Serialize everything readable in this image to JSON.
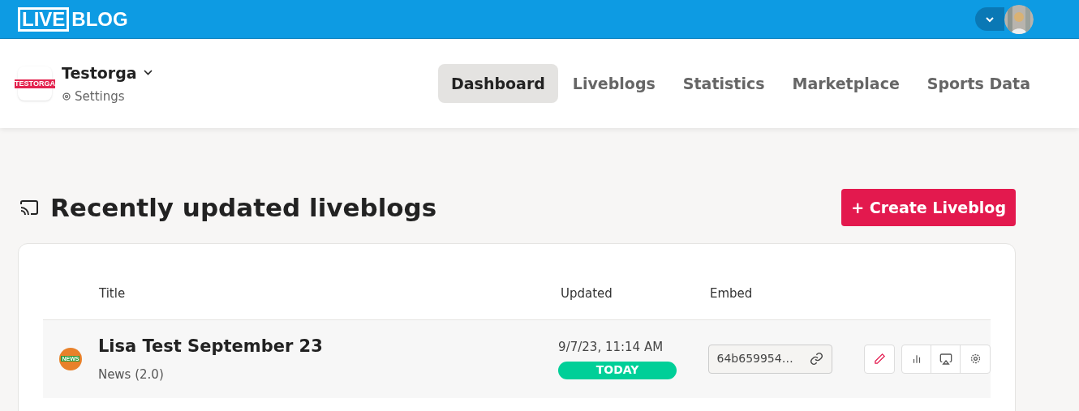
{
  "logo": {
    "boxed": "LIVE",
    "rest": "BLOG"
  },
  "org": {
    "name": "Testorga",
    "logo_text": "TESTORGA",
    "settings": "Settings"
  },
  "nav": [
    {
      "label": "Dashboard",
      "selected": true
    },
    {
      "label": "Liveblogs",
      "selected": false
    },
    {
      "label": "Statistics",
      "selected": false
    },
    {
      "label": "Marketplace",
      "selected": false
    },
    {
      "label": "Sports Data",
      "selected": false
    }
  ],
  "section": {
    "title": "Recently updated liveblogs",
    "create_button": "+ Create Liveblog"
  },
  "table": {
    "columns": [
      "Title",
      "Updated",
      "Embed"
    ],
    "rows": [
      {
        "title": "Lisa Test September 23",
        "type": "News (2.0)",
        "icon_text": "NEWS",
        "updated": "9/7/23, 11:14 AM",
        "badge": "TODAY",
        "embed": "64b659954…"
      }
    ]
  }
}
